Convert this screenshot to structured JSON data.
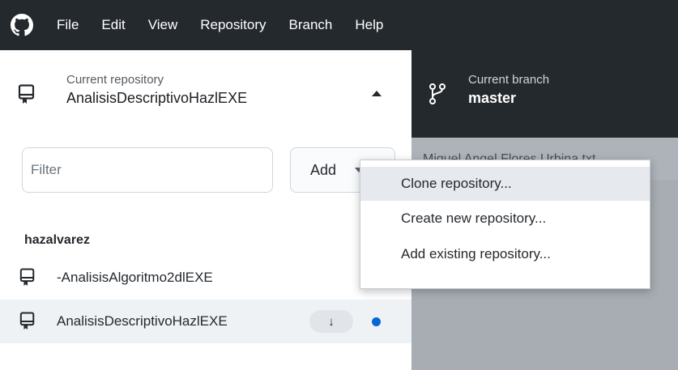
{
  "menubar": {
    "items": [
      "File",
      "Edit",
      "View",
      "Repository",
      "Branch",
      "Help"
    ]
  },
  "repository": {
    "caption": "Current repository",
    "name": "AnalisisDescriptivoHazlEXE"
  },
  "filter": {
    "placeholder": "Filter"
  },
  "add_button": {
    "label": "Add"
  },
  "repo_list": {
    "group": "hazalvarez",
    "items": [
      {
        "label": "-AnalisisAlgoritmo2dlEXE"
      },
      {
        "label": "AnalisisDescriptivoHazlEXE",
        "badge": "↓"
      }
    ]
  },
  "branch": {
    "caption": "Current branch",
    "name": "master"
  },
  "changes": {
    "file": "Miguel Angel Flores Urbina.txt"
  },
  "add_menu": {
    "items": [
      "Clone repository...",
      "Create new repository...",
      "Add existing repository..."
    ]
  },
  "colors": {
    "titlebar": "#24292e",
    "accent_dot": "#0366d6",
    "selected_row": "#eff2f5",
    "overlay": "#a8adb3"
  }
}
